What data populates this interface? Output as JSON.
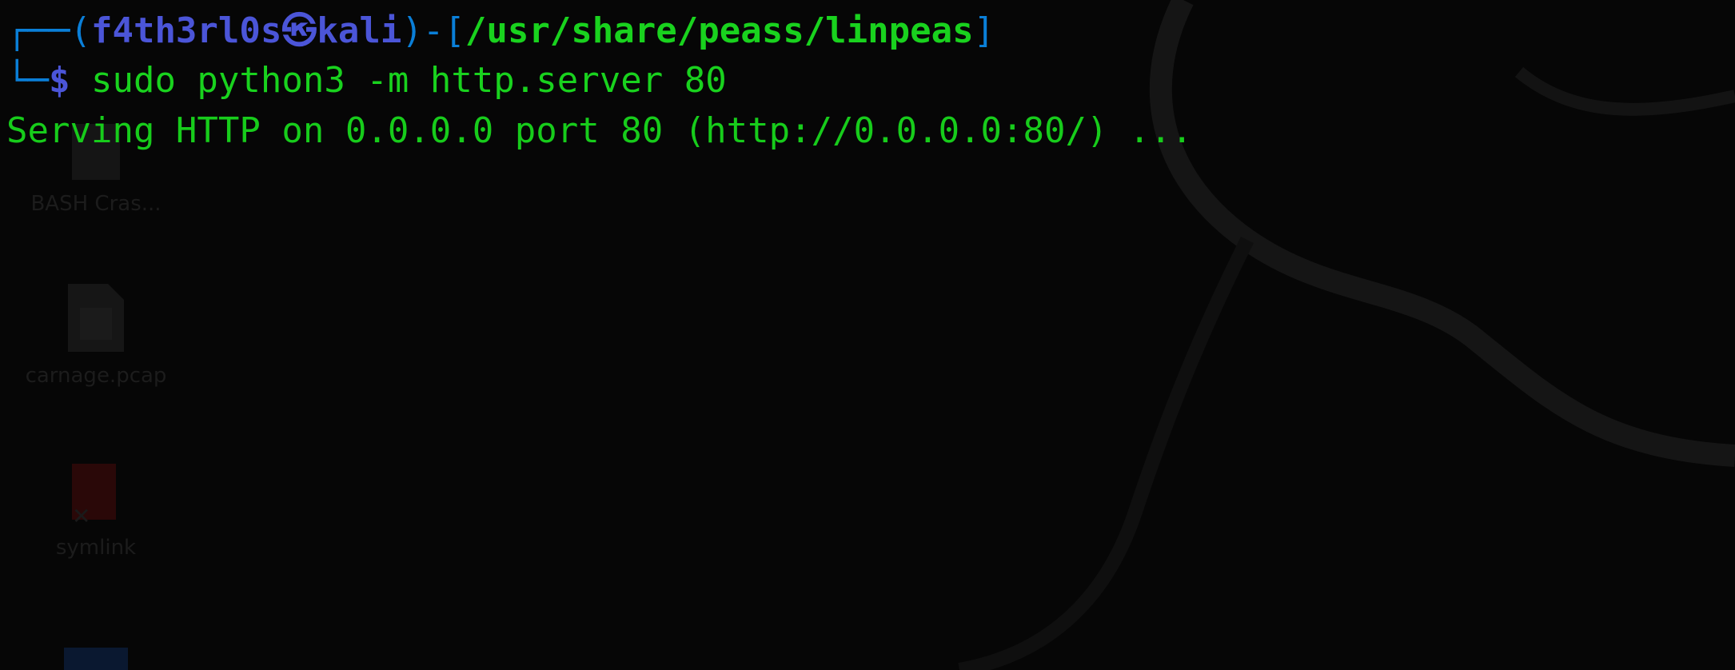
{
  "prompt": {
    "corner_top": "┌──(",
    "user": "f4th3rl0s",
    "at_symbol": "㉿",
    "host": "kali",
    "sep": ")-[",
    "path": "/usr/share/peass/linpeas",
    "close": "]",
    "corner_bottom": "└─",
    "dollar": "$"
  },
  "command": "sudo python3 -m http.server 80",
  "output": "Serving HTTP on 0.0.0.0 port 80 (http://0.0.0.0:80/) ...",
  "desktop_icons": [
    {
      "label": "BASH Cras...",
      "icon": "file-icon"
    },
    {
      "label": "carnage.pcap",
      "icon": "pcap-file-icon"
    },
    {
      "label": "symlink",
      "icon": "broken-symlink-icon"
    },
    {
      "label": "",
      "icon": "folder-icon"
    }
  ],
  "colors": {
    "background": "#060606",
    "prompt_blue": "#4b55d8",
    "path_green": "#19d21e",
    "output_green": "#17cc1b"
  }
}
